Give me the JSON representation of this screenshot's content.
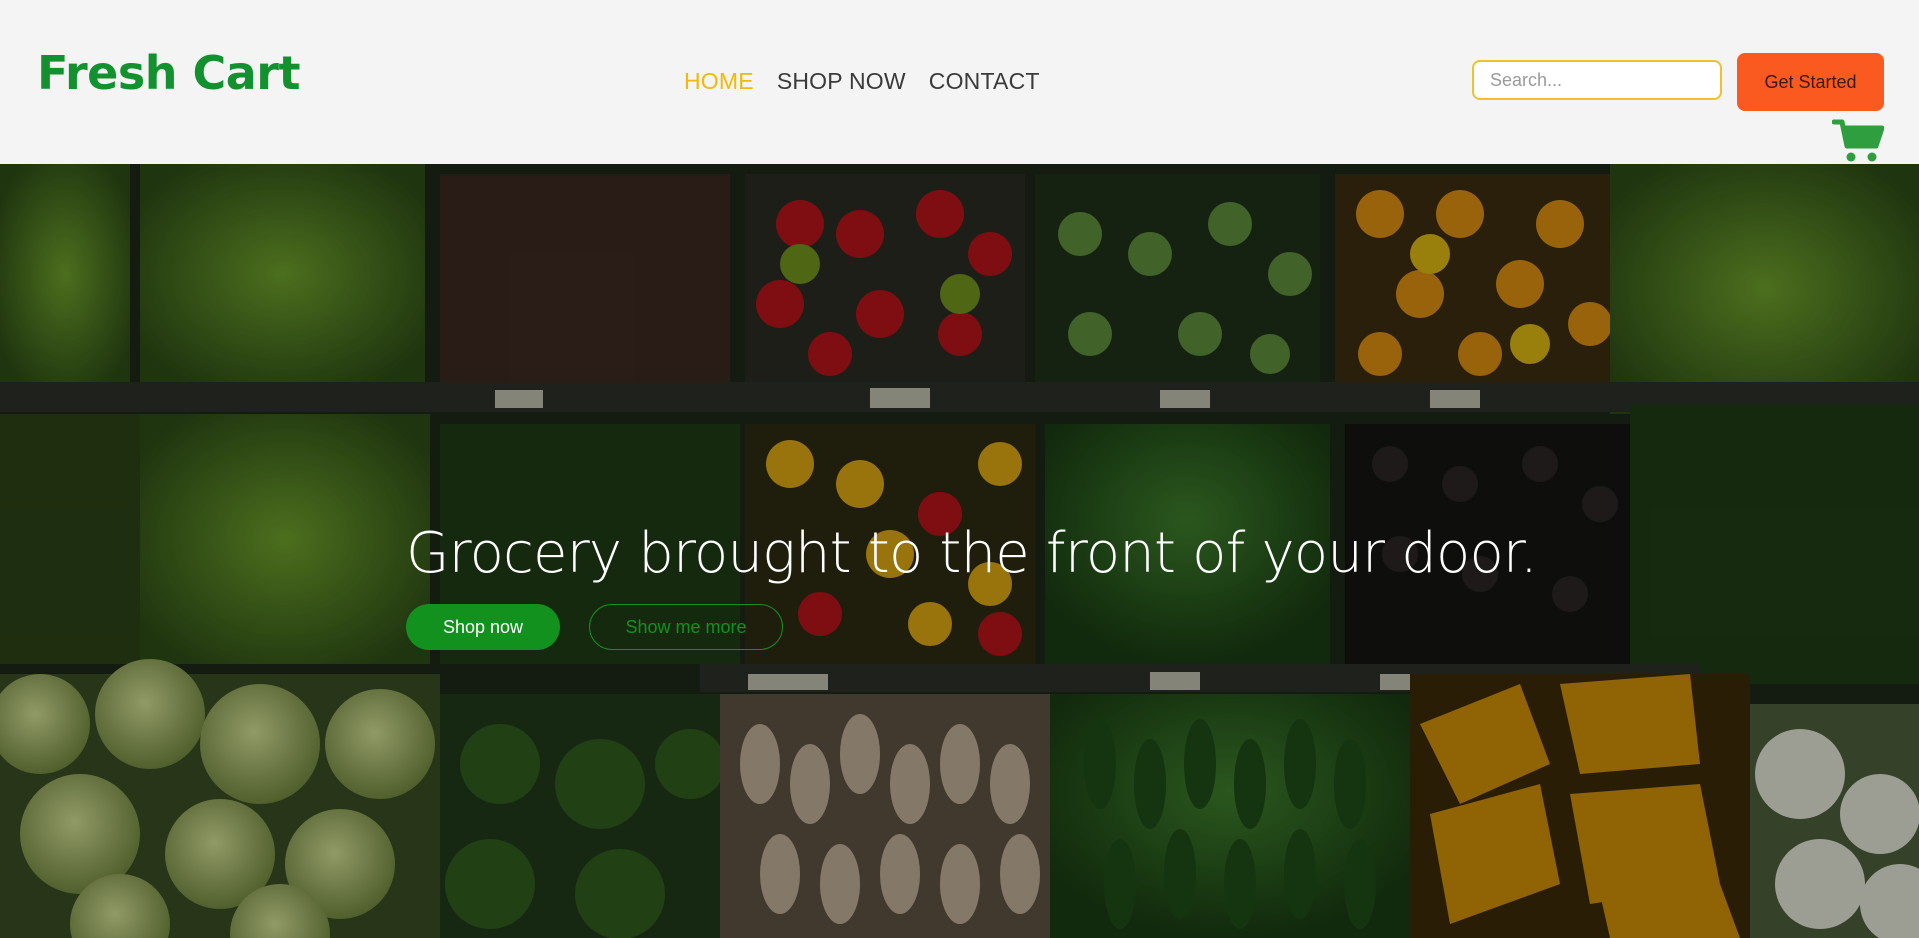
{
  "brand": {
    "name": "Fresh Cart",
    "color": "#13912f"
  },
  "nav": {
    "items": [
      {
        "label": "HOME",
        "active": true
      },
      {
        "label": "SHOP NOW",
        "active": false
      },
      {
        "label": "CONTACT",
        "active": false
      }
    ],
    "active_color": "#f0b90b"
  },
  "search": {
    "placeholder": "Search...",
    "value": ""
  },
  "header_cta": {
    "label": "Get Started",
    "color": "#fa5a1f"
  },
  "cart": {
    "icon": "shopping-cart-icon",
    "color": "#2e9e3e"
  },
  "hero": {
    "background": "grocery-produce-shelves",
    "headline": "Grocery brought to the front of your door.",
    "primary_button": "Shop now",
    "secondary_button": "Show me more",
    "accent_color": "#13911f"
  }
}
